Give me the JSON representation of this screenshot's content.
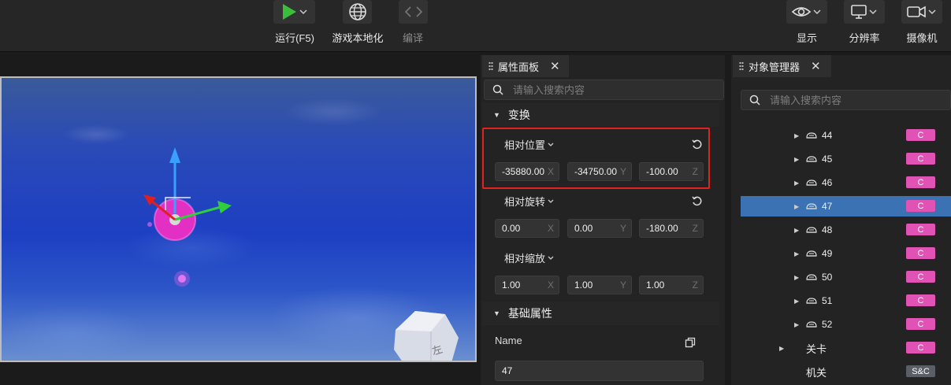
{
  "toolbar": {
    "run_label": "运行(F5)",
    "localize_label": "游戏本地化",
    "compile_label": "编译",
    "display_label": "显示",
    "resolution_label": "分辨率",
    "camera_label": "摄像机",
    "colors": {
      "play_green": "#3bbf3b",
      "toolbar_bg": "#262626"
    }
  },
  "viewport": {
    "gizmo_label": "左"
  },
  "properties": {
    "tab_label": "属性面板",
    "search_placeholder": "请输入搜索内容",
    "transform_section": "变换",
    "position": {
      "label": "相对位置",
      "x": "-35880.00",
      "y": "-34750.00",
      "z": "-100.00"
    },
    "rotation": {
      "label": "相对旋转",
      "x": "0.00",
      "y": "0.00",
      "z": "-180.00"
    },
    "scale": {
      "label": "相对缩放",
      "x": "1.00",
      "y": "1.00",
      "z": "1.00"
    },
    "axis_x": "X",
    "axis_y": "Y",
    "axis_z": "Z",
    "basic_section": "基础属性",
    "name_label": "Name",
    "name_value": "47",
    "highlight_color": "#e0231c"
  },
  "object_manager": {
    "tab_label": "对象管理器",
    "search_placeholder": "请输入搜索内容",
    "items": [
      {
        "label": "44",
        "badge": "C"
      },
      {
        "label": "45",
        "badge": "C"
      },
      {
        "label": "46",
        "badge": "C"
      },
      {
        "label": "47",
        "badge": "C"
      },
      {
        "label": "48",
        "badge": "C"
      },
      {
        "label": "49",
        "badge": "C"
      },
      {
        "label": "50",
        "badge": "C"
      },
      {
        "label": "51",
        "badge": "C"
      },
      {
        "label": "52",
        "badge": "C"
      }
    ],
    "level_label": "关卡",
    "level_badge": "C",
    "mechanism_label": "机关",
    "mechanism_badge": "S&C",
    "selected_color": "#3a72b3",
    "badge_color": "#e052b4"
  }
}
